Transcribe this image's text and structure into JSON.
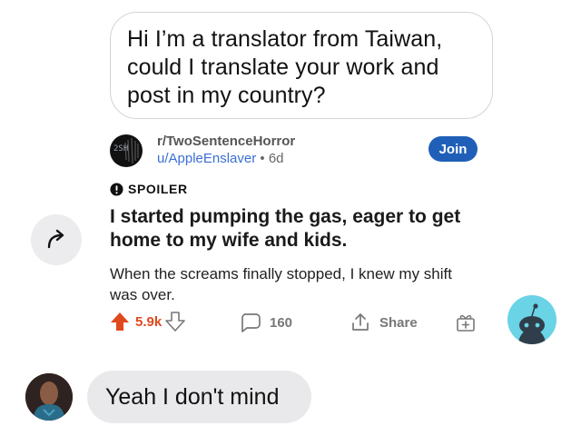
{
  "outgoing_message": {
    "lines": [
      "Hi I’m a translator from Taiwan,",
      "could I translate your work and",
      "post in my country?"
    ]
  },
  "post": {
    "subreddit": "r/TwoSentenceHorror",
    "author": "u/AppleEnslaver",
    "separator": "•",
    "age": "6d",
    "join_label": "Join",
    "spoiler_label": "SPOILER",
    "title": "I started pumping the gas, eager to get home to my wife and kids.",
    "body": "When the screams finally stopped, I knew my shift was over.",
    "score": "5.9k",
    "comments": "160",
    "share_label": "Share",
    "avatar_text": "2SH"
  },
  "icons": {
    "share": "share-arrow-icon",
    "upvote": "upvote-arrow-icon",
    "downvote": "downvote-arrow-icon",
    "comment": "comment-bubble-icon",
    "share_post": "share-upload-icon",
    "award": "gift-award-icon",
    "snoo": "reddit-snoo-icon",
    "spoiler": "exclamation-circle-icon"
  },
  "incoming_message": {
    "text": "Yeah I don't mind"
  },
  "colors": {
    "upvote": "#e0491d",
    "join": "#1f5fb8",
    "author": "#3b6fd4",
    "snoo_bg": "#6ad3e5",
    "bubble_in": "#e9e9eb"
  }
}
